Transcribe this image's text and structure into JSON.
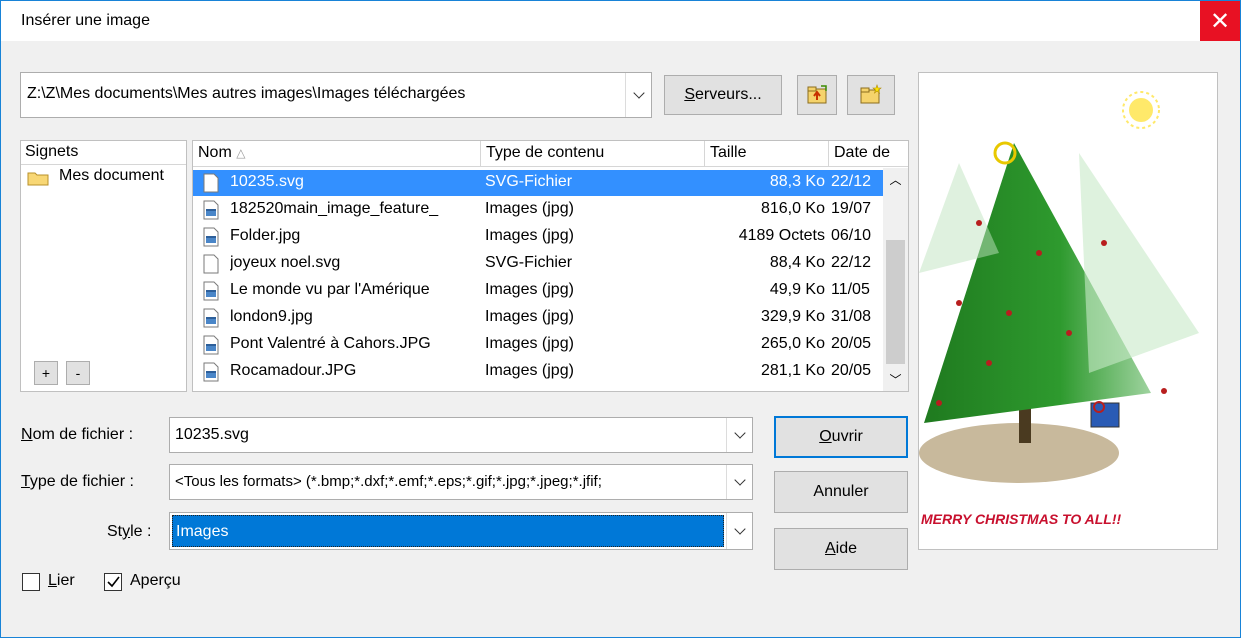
{
  "window": {
    "title": "Insérer une image"
  },
  "path": {
    "value": "Z:\\Z\\Mes documents\\Mes autres images\\Images téléchargées"
  },
  "toolbar": {
    "servers_label": "Serveurs...",
    "servers_mnemonic": "S",
    "servers_rest": "erveurs..."
  },
  "bookmarks": {
    "header": "Signets",
    "items": [
      {
        "label": "Mes document"
      }
    ],
    "add_label": "+",
    "remove_label": "-"
  },
  "files": {
    "columns": [
      "Nom",
      "Type de contenu",
      "Taille",
      "Date de"
    ],
    "rows": [
      {
        "name": "10235.svg",
        "type": "SVG-Fichier",
        "size": "88,3 Ko",
        "date": "22/12",
        "selected": true,
        "icon": "svg-file-icon"
      },
      {
        "name": "182520main_image_feature_",
        "type": "Images (jpg)",
        "size": "816,0 Ko",
        "date": "19/07",
        "icon": "image-file-icon"
      },
      {
        "name": "Folder.jpg",
        "type": "Images (jpg)",
        "size": "4189 Octets",
        "date": "06/10",
        "icon": "image-file-icon"
      },
      {
        "name": "joyeux noel.svg",
        "type": "SVG-Fichier",
        "size": "88,4 Ko",
        "date": "22/12",
        "icon": "svg-file-icon"
      },
      {
        "name": "Le monde vu par l'Amérique",
        "type": "Images (jpg)",
        "size": "49,9 Ko",
        "date": "11/05",
        "icon": "image-file-icon"
      },
      {
        "name": "london9.jpg",
        "type": "Images (jpg)",
        "size": "329,9 Ko",
        "date": "31/08",
        "icon": "image-file-icon"
      },
      {
        "name": "Pont Valentré à Cahors.JPG",
        "type": "Images (jpg)",
        "size": "265,0 Ko",
        "date": "20/05",
        "icon": "image-file-icon"
      },
      {
        "name": "Rocamadour.JPG",
        "type": "Images (jpg)",
        "size": "281,1 Ko",
        "date": "20/05",
        "icon": "image-file-icon"
      }
    ]
  },
  "form": {
    "filename_label_m": "N",
    "filename_label_rest": "om de fichier :",
    "filename_value": "10235.svg",
    "filetype_label_m": "T",
    "filetype_label_rest": "ype de fichier :",
    "filetype_value": "<Tous les formats> (*.bmp;*.dxf;*.emf;*.eps;*.gif;*.jpg;*.jpeg;*.jfif;",
    "style_label_pre": "St",
    "style_label_m": "y",
    "style_label_rest": "le :",
    "style_value": "Images"
  },
  "buttons": {
    "open_m": "O",
    "open_rest": "uvrir",
    "cancel": "Annuler",
    "help_m": "A",
    "help_rest": "ide"
  },
  "options": {
    "link_m": "L",
    "link_rest": "ier",
    "link_checked": false,
    "preview_label": "Aperçu",
    "preview_checked": true
  },
  "preview": {
    "caption": "MERRY CHRISTMAS TO ALL!!"
  }
}
